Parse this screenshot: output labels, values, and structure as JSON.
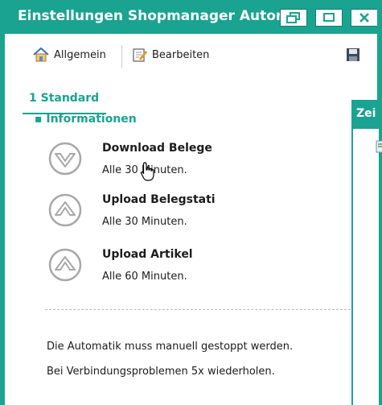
{
  "window": {
    "title": "Einstellungen Shopmanager Automatik",
    "restore_icon": "restore-icon",
    "minimize_icon": "minimize-icon",
    "close_icon": "close-icon"
  },
  "toolbar": {
    "general_label": "Allgemein",
    "edit_label": "Bearbeiten",
    "save_icon": "save-icon"
  },
  "section": {
    "tab_label": "1 Standard",
    "sub_label": "Informationen"
  },
  "tasks": [
    {
      "title": "Download Belege",
      "interval": "Alle 30 Minuten.",
      "icon": "download-arrow-icon"
    },
    {
      "title": "Upload Belegstati",
      "interval": "Alle 30 Minuten.",
      "icon": "upload-arrow-icon"
    },
    {
      "title": "Upload Artikel",
      "interval": "Alle 60 Minuten.",
      "icon": "upload-arrow-icon"
    }
  ],
  "notes": [
    "Die Automatik muss manuell gestoppt werden.",
    "Bei Verbindungsproblemen 5x wiederholen."
  ],
  "side_window": {
    "title": "Zei"
  },
  "colors": {
    "accent": "#1aa391",
    "text": "#1c1c1c"
  }
}
